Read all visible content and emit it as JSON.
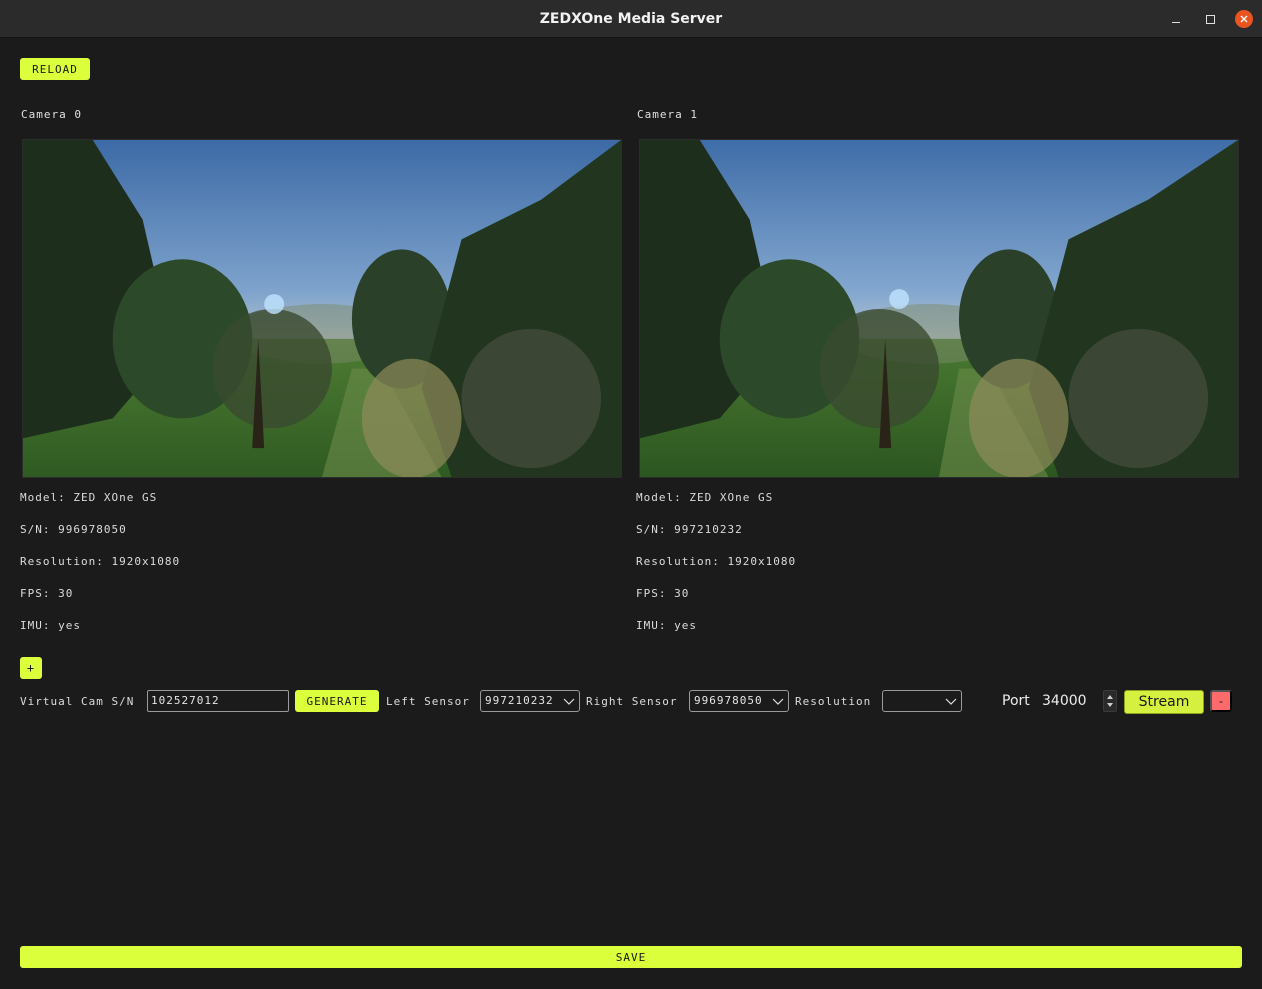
{
  "window": {
    "title": "ZEDXOne Media Server",
    "controls": [
      "minimize-icon",
      "maximize-icon",
      "close-icon"
    ]
  },
  "toolbar": {
    "reload_label": "RELOAD"
  },
  "cameras": [
    {
      "label": "Camera 0",
      "model": "Model: ZED XOne GS",
      "sn": "S/N: 996978050",
      "resolution": "Resolution: 1920x1080",
      "fps": "FPS: 30",
      "imu": "IMU: yes"
    },
    {
      "label": "Camera 1",
      "model": "Model: ZED XOne GS",
      "sn": "S/N: 997210232",
      "resolution": "Resolution: 1920x1080",
      "fps": "FPS: 30",
      "imu": "IMU: yes"
    }
  ],
  "add_label": "+",
  "virtual_cam": {
    "sn_label": "Virtual Cam S/N",
    "sn_value": "102527012",
    "generate_label": "GENERATE",
    "left_sensor_label": "Left Sensor",
    "left_sensor_value": "997210232",
    "right_sensor_label": "Right Sensor",
    "right_sensor_value": "996978050",
    "resolution_label": "Resolution",
    "resolution_value": "",
    "port_label": "Port",
    "port_value": "34000",
    "stream_label": "Stream",
    "remove_label": "-"
  },
  "save_label": "SAVE",
  "colors": {
    "accent": "#dbff3b",
    "danger": "#ff6b6b",
    "background": "#1b1b1c",
    "titlebar": "#2b2b2b",
    "close_button": "#e95420"
  }
}
